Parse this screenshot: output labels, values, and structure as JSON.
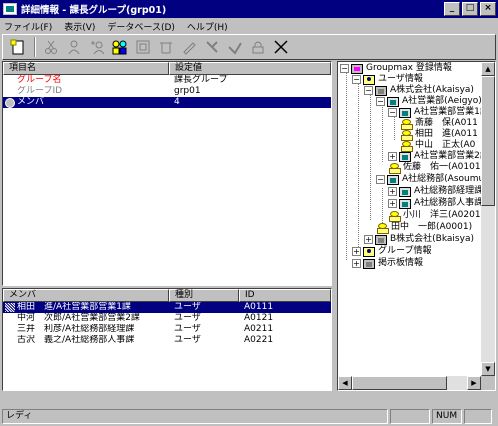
{
  "window": {
    "title": "詳細情報 - 課長グループ(grp01)",
    "buttons": [
      "_",
      "□",
      "×"
    ]
  },
  "menu": [
    "ファイル(F)",
    "表示(V)",
    "データベース(D)",
    "ヘルプ(H)"
  ],
  "toolbar": {
    "icons": [
      "new-icon",
      "cut-user-icon",
      "user-icon",
      "add-user-icon",
      "group-icon",
      "copy-icon",
      "paste-icon",
      "edit-icon",
      "tool-icon",
      "delete-user-icon",
      "lock-icon",
      "delete-icon"
    ]
  },
  "properties": {
    "headers": [
      "項目名",
      "設定値"
    ],
    "rows": [
      {
        "name": "グループ名",
        "value": "課長グループ",
        "name_color": "#ff0000"
      },
      {
        "name": "グループID",
        "value": "grp01",
        "name_color": "#808080"
      },
      {
        "name": "メンバ",
        "value": "4",
        "selected": true
      }
    ]
  },
  "members": {
    "headers": [
      "メンバ",
      "種別",
      "ID"
    ],
    "rows": [
      {
        "name": "相田　進/A社営業部営業1課",
        "type": "ユーザ",
        "id": "A0111",
        "selected": true
      },
      {
        "name": "中河　次郎/A社営業部営業2課",
        "type": "ユーザ",
        "id": "A0121"
      },
      {
        "name": "三井　利彦/A社総務部経理課",
        "type": "ユーザ",
        "id": "A0211"
      },
      {
        "name": "古沢　義之/A社総務部人事課",
        "type": "ユーザ",
        "id": "A0221"
      }
    ]
  },
  "tree": {
    "nodes": [
      "Groupmax 登録情報",
      "ユーザ情報",
      "A株式会社(Akaisya)",
      "A社営業部(Aeigyo)",
      "A社営業部営業1課",
      "斎藤　保(A011",
      "相田　進(A011",
      "中山　正太(A0",
      "A社営業部営業2課",
      "佐藤　佑一(A0101)",
      "A社総務部(Asoumu)",
      "A社総務部経理課",
      "A社総務部人事課",
      "小川　洋三(A0201)",
      "田中　一郎(A0001)",
      "B株式会社(Bkaisya)",
      "グループ情報",
      "掲示板情報"
    ]
  },
  "status": {
    "text": "レディ",
    "num": "NUM"
  }
}
